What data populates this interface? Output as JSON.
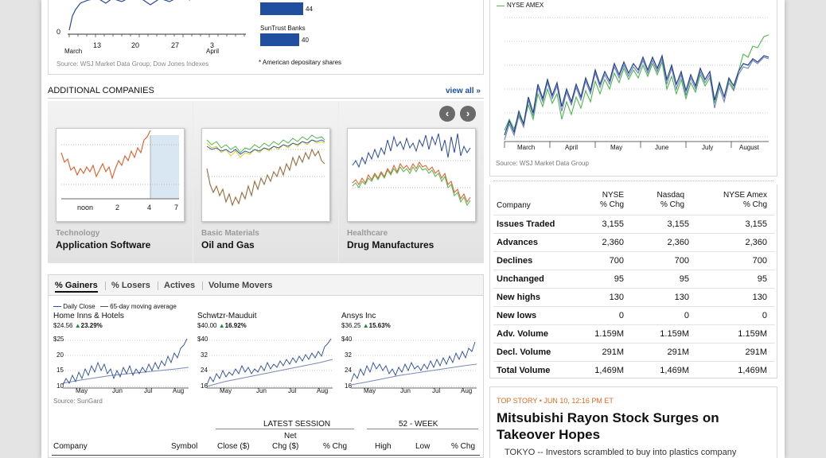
{
  "top_chart": {
    "y_tick": "0",
    "x_ticks": [
      "13",
      "20",
      "27",
      "3"
    ],
    "x_months": [
      "March",
      "April"
    ],
    "source": "Source: WSJ Market Data Group; Dow Jones Indexes"
  },
  "adr_bars": {
    "items": [
      {
        "label": "",
        "value": 44
      },
      {
        "label": "SunTrust Banks",
        "value": 40
      }
    ],
    "footnote": "* American depositary shares"
  },
  "additional_companies": {
    "title": "ADDITIONAL COMPANIES",
    "view_all": "view all »",
    "prev_icon": "chevron-left-icon",
    "next_icon": "chevron-right-icon",
    "cards": [
      {
        "sector": "Technology",
        "industry": "Application Software",
        "ticks": [
          "noon",
          "2",
          "4",
          "7"
        ]
      },
      {
        "sector": "Basic Materials",
        "industry": "Oil and Gas"
      },
      {
        "sector": "Healthcare",
        "industry": "Drug Manufactures"
      }
    ]
  },
  "movers": {
    "tabs": [
      "% Gainers",
      "% Losers",
      "Actives",
      "Volume Movers"
    ],
    "active_tab": 0,
    "legend_daily": "Daily Close",
    "legend_ma": "65-day moving average",
    "charts": [
      {
        "name": "Home Inns & Hotels",
        "price": "$24.56",
        "change": "23.29%",
        "y_ticks": [
          "$25",
          "20",
          "15",
          "10"
        ],
        "x_ticks": [
          "May",
          "Jun",
          "Jul",
          "Aug"
        ]
      },
      {
        "name": "Schwtzr-Mauduit",
        "price": "$40.00",
        "change": "16.92%",
        "y_ticks": [
          "$40",
          "32",
          "24",
          "16"
        ],
        "x_ticks": [
          "May",
          "Jun",
          "Jul",
          "Aug"
        ]
      },
      {
        "name": "Ansys Inc",
        "price": "$36.25",
        "change": "15.63%",
        "y_ticks": [
          "$40",
          "32",
          "24",
          "16"
        ],
        "x_ticks": [
          "May",
          "Jun",
          "Jul",
          "Aug"
        ]
      }
    ],
    "source": "Source: SunGard",
    "table_group_latest": "LATEST SESSION",
    "table_group_52": "52 - WEEK",
    "columns": {
      "company": "Company",
      "symbol": "Symbol",
      "close": "Close ($)",
      "net_top": "Net",
      "net_chg": "Chg ($)",
      "pct_chg": "% Chg",
      "high": "High",
      "low": "Low",
      "pct_chg_52": "% Chg"
    }
  },
  "index_chart": {
    "legend": "NYSE AMEX",
    "months": [
      "March",
      "April",
      "May",
      "June",
      "July",
      "August"
    ],
    "source": "Source: WSJ Market Data Group",
    "colors": {
      "nyse": "#1f3f8f",
      "nasdaq": "#6f7fb8",
      "amex": "#4cb848"
    }
  },
  "market_diary": {
    "head_company": "Company",
    "columns": [
      {
        "top": "NYSE",
        "bottom": "% Chg"
      },
      {
        "top": "Nasdaq",
        "bottom": "% Chg"
      },
      {
        "top": "NYSE Amex",
        "bottom": "% Chg"
      }
    ],
    "rows": [
      {
        "label": "Issues Traded",
        "values": [
          "3,155",
          "3,155",
          "3,155"
        ]
      },
      {
        "label": "Advances",
        "values": [
          "2,360",
          "2,360",
          "2,360"
        ]
      },
      {
        "label": "Declines",
        "values": [
          "700",
          "700",
          "700"
        ]
      },
      {
        "label": "Unchanged",
        "values": [
          "95",
          "95",
          "95"
        ]
      },
      {
        "label": "New highs",
        "values": [
          "130",
          "130",
          "130"
        ]
      },
      {
        "label": "New lows",
        "values": [
          "0",
          "0",
          "0"
        ]
      },
      {
        "label": "Adv. Volume",
        "values": [
          "1.159M",
          "1.159M",
          "1.159M"
        ]
      },
      {
        "label": "Decl. Volume",
        "values": [
          "291M",
          "291M",
          "291M"
        ]
      },
      {
        "label": "Total Volume",
        "values": [
          "1,469M",
          "1,469M",
          "1,469M"
        ]
      }
    ]
  },
  "top_story": {
    "kicker": "TOP STORY • JUN 10, 12:16 PM ET",
    "headline": "Mitsubishi Rayon Stock Surges on Takeover Hopes",
    "summary": "TOKYO -- Investors scrambled to buy into plastics company"
  }
}
